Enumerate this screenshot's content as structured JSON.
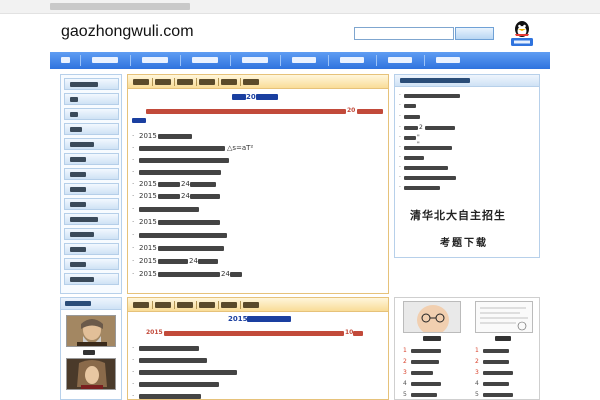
{
  "header": {
    "logo_text": "gaozhongwuli.com"
  },
  "banner": {
    "line1": "清华北大自主招生",
    "line2": "考题下载"
  },
  "panel_top": {
    "title_number": "20",
    "summary_number": "20",
    "list": [
      {
        "prefix_num": "2015"
      },
      {
        "formula": "△s=aT²"
      },
      {},
      {},
      {
        "prefix_num": "2015",
        "middle_num": "24"
      },
      {
        "prefix_num": "2015",
        "middle_num": "24"
      },
      {},
      {
        "prefix_num": "2015"
      },
      {},
      {
        "prefix_num": "2015"
      },
      {
        "prefix_num": "2015",
        "middle_num": "24"
      },
      {
        "prefix_num": "2015",
        "middle_num": "24"
      }
    ]
  },
  "panel_bottom": {
    "title_number": "2015",
    "summary_number": "2015",
    "summary_tail": "10"
  },
  "right_list": {
    "items": [
      {},
      {},
      {},
      {
        "q_number": "2"
      },
      {
        "quoted": "\"   \""
      },
      {},
      {},
      {},
      {}
    ]
  },
  "ranking": {
    "left": [
      "1",
      "2",
      "3",
      "4",
      "5",
      "6"
    ],
    "right": [
      "1",
      "2",
      "3",
      "4",
      "5",
      "6"
    ]
  },
  "colors": {
    "nav_blue": "#2f73de",
    "panel_gold": "#f9dc97",
    "title_blue": "#1a3fa0",
    "summary_red": "#c24a3a"
  },
  "icons": {
    "qq": "qq-penguin-icon"
  }
}
